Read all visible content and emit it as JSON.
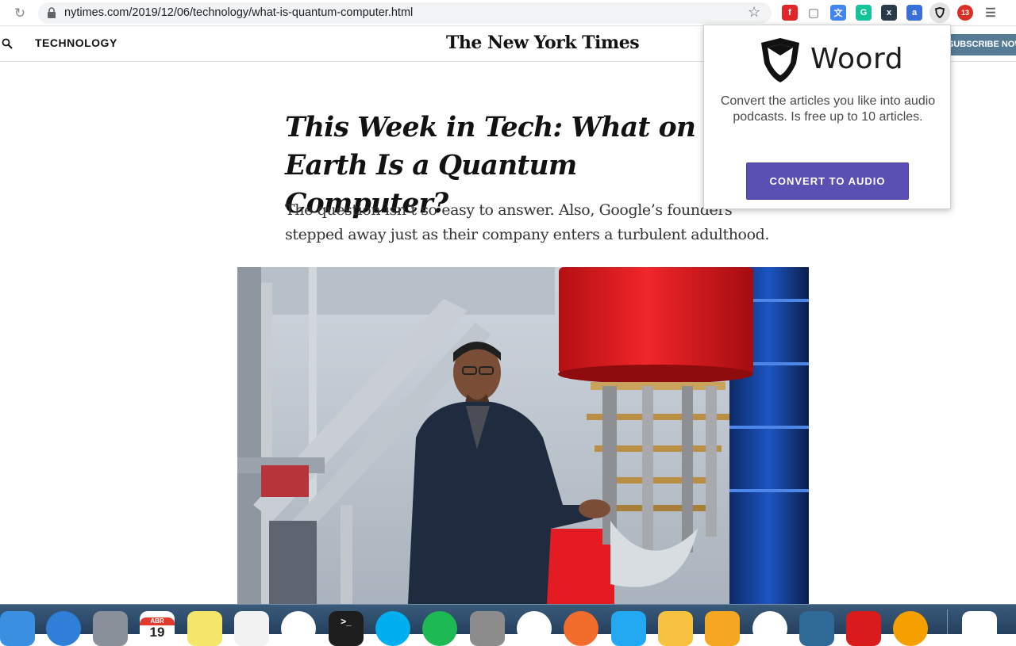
{
  "browser": {
    "url": "nytimes.com/2019/12/06/technology/what-is-quantum-computer.html",
    "reload_icon": "reload-icon",
    "extensions": [
      {
        "name": "flipboard-ext-icon",
        "color": "#e12828",
        "glyph": "f"
      },
      {
        "name": "tab-ext-icon",
        "color": "#9aa0a6",
        "glyph": "▢"
      },
      {
        "name": "translate-ext-icon",
        "color": "#4285f4",
        "glyph": "文"
      },
      {
        "name": "grammarly-ext-icon",
        "color": "#15c39a",
        "glyph": "G"
      },
      {
        "name": "x-ext-icon",
        "color": "#2b3a4a",
        "glyph": "x"
      },
      {
        "name": "adblock-ext-icon",
        "color": "#3b6fd8",
        "glyph": "a"
      },
      {
        "name": "woord-ext-icon",
        "color": "#e3e3e3",
        "glyph": ""
      },
      {
        "name": "badge-ext-icon",
        "color": "#d93025",
        "glyph": "13"
      },
      {
        "name": "reader-ext-icon",
        "color": "#5f6368",
        "glyph": "☰"
      }
    ]
  },
  "nyt": {
    "section": "TECHNOLOGY",
    "masthead": "The New York Times",
    "subscribe": "SUBSCRIBE NOW"
  },
  "article": {
    "headline": "This Week in Tech: What on Earth Is a Quantum Computer?",
    "summary": "The question isn’t so easy to answer. Also, Google’s founders stepped away just as their company enters a turbulent adulthood."
  },
  "popup": {
    "brand": "Woord",
    "description": "Convert the articles you like into audio podcasts. Is free up to 10 articles.",
    "button": "CONVERT TO AUDIO",
    "accent": "#5a4fb3"
  },
  "dock": {
    "calendar_month": "ABR",
    "calendar_day": "19",
    "apps": [
      "finder-icon",
      "safari-icon",
      "launchpad-icon",
      "calendar-icon",
      "notes-icon",
      "textedit-icon",
      "chrome-icon",
      "terminal-icon",
      "skype-icon",
      "spotify-icon",
      "system-preferences-icon",
      "slack-icon",
      "postman-icon",
      "vscode-icon",
      "sketch-icon",
      "transmit-icon",
      "itunes-icon",
      "mysql-workbench-icon",
      "acrobat-icon",
      "vlc-icon",
      "woord-app-icon"
    ]
  }
}
